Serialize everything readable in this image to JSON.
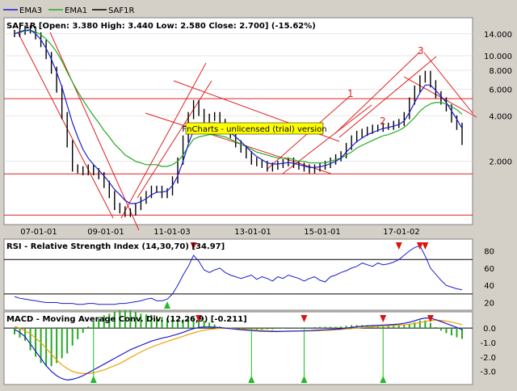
{
  "legend": {
    "items": [
      {
        "name": "EMA3",
        "color": "#1c1cd0"
      },
      {
        "name": "EMA1",
        "color": "#22aa22"
      },
      {
        "name": "SAF1R",
        "color": "#000000"
      }
    ]
  },
  "watermark": "FnCharts - unlicensed (trial) version",
  "panels": {
    "price": {
      "header": "SAF1R [Open: 3.380  High: 3.440  Low: 2.580  Close: 2.700] (-15.62%)"
    },
    "rsi": {
      "header": "RSI - Relative Strength Index (14,30,70) [34.97]"
    },
    "macd": {
      "header": "MACD - Moving Average Conv. Div. (12,26,9) [-0.211]"
    }
  },
  "colors": {
    "ema3": "#1c1cd0",
    "ema1": "#22aa22",
    "price": "#000000",
    "trendlines": "#e02020",
    "signal": "#f0a000",
    "histogram": "#22aa22",
    "buy_marker": "#22bb22",
    "sell_marker": "#dd1111",
    "watermark_bg": "#ffff00"
  },
  "chart_data": [
    {
      "type": "line",
      "name": "price",
      "y_scale": "log",
      "x_tick_labels": [
        "07-01-01",
        "09-01-01",
        "11-01-03",
        "13-01-01",
        "15-01-01",
        "17-01-02"
      ],
      "y_ticks": [
        2.0,
        4.0,
        6.0,
        8.0,
        10.0,
        14.0
      ],
      "y_tick_labels": [
        "2.000",
        "4.000",
        "6.000",
        "8.000",
        "10.000",
        "14.000"
      ],
      "ylim": [
        0.8,
        17.0
      ],
      "horizontal_levels": [
        5.2,
        1.65,
        0.88
      ],
      "wave_labels": [
        "1",
        "2",
        "3"
      ],
      "series": [
        {
          "name": "SAF1R",
          "values": [
            14.0,
            14.5,
            15.0,
            14.8,
            13.5,
            12.0,
            10.0,
            8.0,
            6.0,
            4.0,
            2.6,
            1.8,
            1.75,
            1.7,
            1.8,
            1.7,
            1.6,
            1.4,
            1.2,
            1.0,
            0.95,
            0.9,
            0.92,
            1.0,
            1.1,
            1.2,
            1.3,
            1.3,
            1.2,
            1.25,
            1.5,
            2.0,
            2.8,
            4.0,
            4.8,
            4.2,
            3.8,
            3.9,
            4.0,
            3.6,
            3.2,
            3.0,
            2.6,
            2.4,
            2.2,
            2.0,
            1.95,
            1.9,
            1.8,
            1.85,
            1.9,
            1.95,
            2.0,
            1.9,
            1.85,
            1.8,
            1.75,
            1.8,
            1.85,
            1.9,
            2.0,
            2.1,
            2.2,
            2.5,
            2.8,
            3.0,
            3.1,
            3.2,
            3.3,
            3.3,
            3.4,
            3.4,
            3.5,
            3.6,
            4.0,
            5.0,
            6.0,
            7.0,
            7.5,
            6.5,
            5.5,
            5.0,
            4.5,
            3.8,
            3.4,
            2.7
          ]
        },
        {
          "name": "EMA1",
          "values": [
            14.0,
            14.3,
            14.6,
            14.7,
            14.4,
            13.8,
            12.9,
            11.8,
            10.6,
            9.2,
            7.8,
            6.7,
            5.8,
            5.1,
            4.5,
            4.0,
            3.6,
            3.2,
            2.9,
            2.6,
            2.4,
            2.2,
            2.1,
            2.0,
            1.95,
            1.9,
            1.9,
            1.9,
            1.85,
            1.85,
            1.9,
            2.0,
            2.2,
            2.5,
            2.8,
            2.9,
            2.95,
            3.0,
            3.0,
            2.95,
            2.9,
            2.8,
            2.7,
            2.6,
            2.5,
            2.4,
            2.3,
            2.25,
            2.2,
            2.15,
            2.1,
            2.1,
            2.1,
            2.05,
            2.0,
            2.0,
            1.95,
            1.95,
            1.95,
            1.95,
            2.0,
            2.05,
            2.1,
            2.2,
            2.3,
            2.45,
            2.55,
            2.65,
            2.75,
            2.85,
            2.95,
            3.0,
            3.1,
            3.2,
            3.35,
            3.6,
            3.9,
            4.3,
            4.6,
            4.8,
            4.9,
            4.9,
            4.8,
            4.6,
            4.4,
            4.1
          ]
        },
        {
          "name": "EMA3",
          "values": [
            14.0,
            14.4,
            14.8,
            14.8,
            14.0,
            12.8,
            11.2,
            9.5,
            7.8,
            6.2,
            4.7,
            3.6,
            2.9,
            2.4,
            2.1,
            1.9,
            1.75,
            1.6,
            1.45,
            1.3,
            1.2,
            1.1,
            1.05,
            1.05,
            1.08,
            1.13,
            1.2,
            1.25,
            1.25,
            1.27,
            1.38,
            1.6,
            2.0,
            2.6,
            3.2,
            3.4,
            3.5,
            3.55,
            3.6,
            3.5,
            3.3,
            3.1,
            2.9,
            2.7,
            2.5,
            2.3,
            2.15,
            2.05,
            1.95,
            1.92,
            1.92,
            1.94,
            1.96,
            1.94,
            1.9,
            1.86,
            1.82,
            1.82,
            1.84,
            1.87,
            1.93,
            2.0,
            2.1,
            2.3,
            2.5,
            2.7,
            2.85,
            3.0,
            3.1,
            3.2,
            3.3,
            3.35,
            3.42,
            3.5,
            3.7,
            4.2,
            4.9,
            5.7,
            6.4,
            6.4,
            5.9,
            5.4,
            4.9,
            4.3,
            3.8,
            3.3
          ]
        }
      ]
    },
    {
      "type": "line",
      "name": "rsi",
      "y_ticks": [
        20,
        40,
        60,
        80
      ],
      "y_tick_labels": [
        "20",
        "40",
        "60",
        "80"
      ],
      "ylim": [
        13,
        90
      ],
      "levels": [
        30,
        70
      ],
      "series": [
        {
          "name": "RSI",
          "values": [
            27,
            25,
            24,
            23,
            22,
            21,
            20,
            20,
            20,
            19,
            19,
            19,
            18,
            18,
            19,
            19,
            18,
            18,
            18,
            18,
            19,
            19,
            20,
            21,
            22,
            24,
            25,
            22,
            22,
            24,
            30,
            40,
            52,
            62,
            75,
            68,
            58,
            55,
            58,
            60,
            55,
            52,
            50,
            48,
            50,
            52,
            47,
            50,
            48,
            45,
            50,
            48,
            52,
            50,
            48,
            45,
            48,
            50,
            46,
            44,
            50,
            52,
            55,
            57,
            60,
            62,
            66,
            64,
            62,
            66,
            64,
            65,
            67,
            70,
            75,
            80,
            84,
            86,
            74,
            60,
            53,
            46,
            40,
            38,
            36,
            35
          ]
        }
      ]
    },
    {
      "type": "line",
      "name": "macd",
      "y_ticks": [
        0.0,
        -1.0,
        -2.0,
        -3.0
      ],
      "y_tick_labels": [
        "0.0",
        "-1.0",
        "-2.0",
        "-3.0"
      ],
      "ylim": [
        -3.8,
        0.9
      ],
      "series": [
        {
          "name": "MACD",
          "values": [
            -0.1,
            -0.3,
            -0.6,
            -1.1,
            -1.6,
            -2.1,
            -2.6,
            -3.0,
            -3.3,
            -3.5,
            -3.6,
            -3.55,
            -3.45,
            -3.3,
            -3.1,
            -2.9,
            -2.7,
            -2.5,
            -2.3,
            -2.1,
            -1.9,
            -1.7,
            -1.5,
            -1.35,
            -1.2,
            -1.05,
            -0.9,
            -0.8,
            -0.7,
            -0.62,
            -0.52,
            -0.42,
            -0.3,
            -0.16,
            -0.04,
            0.04,
            0.08,
            0.08,
            0.06,
            0.03,
            0.0,
            -0.04,
            -0.08,
            -0.11,
            -0.14,
            -0.17,
            -0.2,
            -0.22,
            -0.23,
            -0.24,
            -0.24,
            -0.23,
            -0.22,
            -0.21,
            -0.2,
            -0.19,
            -0.18,
            -0.16,
            -0.14,
            -0.12,
            -0.1,
            -0.08,
            -0.05,
            0.0,
            0.05,
            0.09,
            0.12,
            0.15,
            0.17,
            0.19,
            0.21,
            0.23,
            0.25,
            0.28,
            0.33,
            0.4,
            0.5,
            0.62,
            0.7,
            0.68,
            0.58,
            0.45,
            0.32,
            0.18,
            0.04,
            -0.1
          ]
        },
        {
          "name": "Signal",
          "values": [
            0.1,
            0.0,
            -0.2,
            -0.4,
            -0.7,
            -1.0,
            -1.4,
            -1.8,
            -2.2,
            -2.55,
            -2.8,
            -3.0,
            -3.1,
            -3.15,
            -3.15,
            -3.1,
            -3.0,
            -2.9,
            -2.75,
            -2.6,
            -2.45,
            -2.25,
            -2.05,
            -1.85,
            -1.65,
            -1.48,
            -1.32,
            -1.18,
            -1.05,
            -0.93,
            -0.81,
            -0.69,
            -0.57,
            -0.45,
            -0.33,
            -0.23,
            -0.15,
            -0.09,
            -0.05,
            -0.02,
            -0.01,
            -0.02,
            -0.04,
            -0.06,
            -0.09,
            -0.12,
            -0.14,
            -0.17,
            -0.19,
            -0.2,
            -0.22,
            -0.22,
            -0.22,
            -0.22,
            -0.21,
            -0.21,
            -0.2,
            -0.19,
            -0.18,
            -0.16,
            -0.14,
            -0.12,
            -0.1,
            -0.07,
            -0.04,
            0.0,
            0.03,
            0.06,
            0.09,
            0.12,
            0.14,
            0.16,
            0.18,
            0.2,
            0.23,
            0.27,
            0.32,
            0.38,
            0.46,
            0.52,
            0.55,
            0.53,
            0.48,
            0.41,
            0.33,
            0.24
          ]
        }
      ]
    }
  ]
}
